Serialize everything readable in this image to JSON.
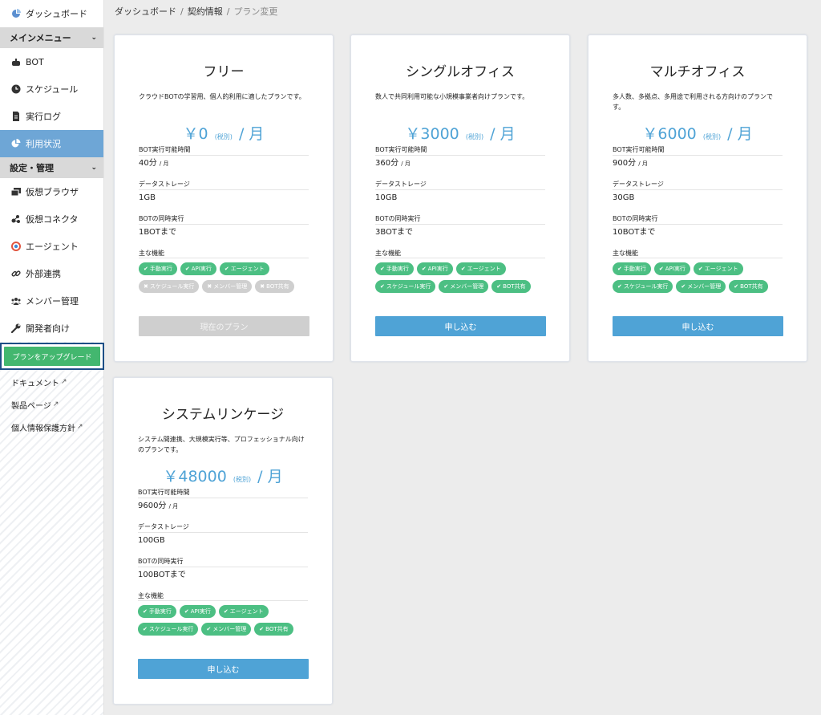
{
  "sidebar": {
    "dashboard": "ダッシュボード",
    "main_menu": "メインメニュー",
    "main_items": [
      "BOT",
      "スケジュール",
      "実行ログ",
      "利用状況"
    ],
    "settings_menu": "設定・管理",
    "settings_items": [
      "仮想ブラウザ",
      "仮想コネクタ",
      "エージェント",
      "外部連携",
      "メンバー管理",
      "開発者向け"
    ],
    "upgrade_button": "プランをアップグレード",
    "links": [
      "ドキュメント",
      "製品ページ",
      "個人情報保護方針"
    ],
    "icons": {
      "dashboard": "dashboard-icon",
      "bot": "robot-icon",
      "schedule": "clock-icon",
      "log": "file-icon",
      "usage": "pie-chart-icon",
      "browser": "window-icon",
      "connector": "connector-icon",
      "agent": "agent-icon",
      "integration": "link-icon",
      "members": "users-icon",
      "developer": "wrench-icon"
    },
    "active_color": "#6ea6d6"
  },
  "breadcrumb": [
    "ダッシュボード",
    "契約情報",
    "プラン変更"
  ],
  "labels": {
    "exec_time": "BOT実行可能時間",
    "storage": "データストレージ",
    "concurrent": "BOTの同時実行",
    "features": "主な機能",
    "tax": "(税別)",
    "per_month": "/ 月",
    "per_month_unit": "/ 月"
  },
  "features": [
    "手動実行",
    "API実行",
    "エージェント",
    "スケジュール実行",
    "メンバー管理",
    "BOT共有"
  ],
  "plans": [
    {
      "name": "フリー",
      "description": "クラウドBOTの学習用、個人的利用に適したプランです。",
      "price": "￥0",
      "exec_time": "40分",
      "storage": "1GB",
      "concurrent": "1BOTまで",
      "features_enabled": [
        true,
        true,
        true,
        false,
        false,
        false
      ],
      "button": "現在のプラン",
      "button_disabled": true
    },
    {
      "name": "シングルオフィス",
      "description": "数人で共同利用可能な小規模事業者向けプランです。",
      "price": "￥3000",
      "exec_time": "360分",
      "storage": "10GB",
      "concurrent": "3BOTまで",
      "features_enabled": [
        true,
        true,
        true,
        true,
        true,
        true
      ],
      "button": "申し込む",
      "button_disabled": false
    },
    {
      "name": "マルチオフィス",
      "description": "多人数、多拠点、多用途で利用される方向けのプランです。",
      "price": "￥6000",
      "exec_time": "900分",
      "storage": "30GB",
      "concurrent": "10BOTまで",
      "features_enabled": [
        true,
        true,
        true,
        true,
        true,
        true
      ],
      "button": "申し込む",
      "button_disabled": false
    },
    {
      "name": "システムリンケージ",
      "description": "システム間連携、大規模実行等、プロフェッショナル向けのプランです。",
      "price": "￥48000",
      "exec_time": "9600分",
      "storage": "100GB",
      "concurrent": "100BOTまで",
      "features_enabled": [
        true,
        true,
        true,
        true,
        true,
        true
      ],
      "button": "申し込む",
      "button_disabled": false
    }
  ],
  "colors": {
    "price": "#4fa3d6",
    "feature_on": "#4cbf83",
    "feature_off": "#cfcfcf",
    "cta": "#4fa3d6",
    "upgrade": "#43b76f"
  }
}
